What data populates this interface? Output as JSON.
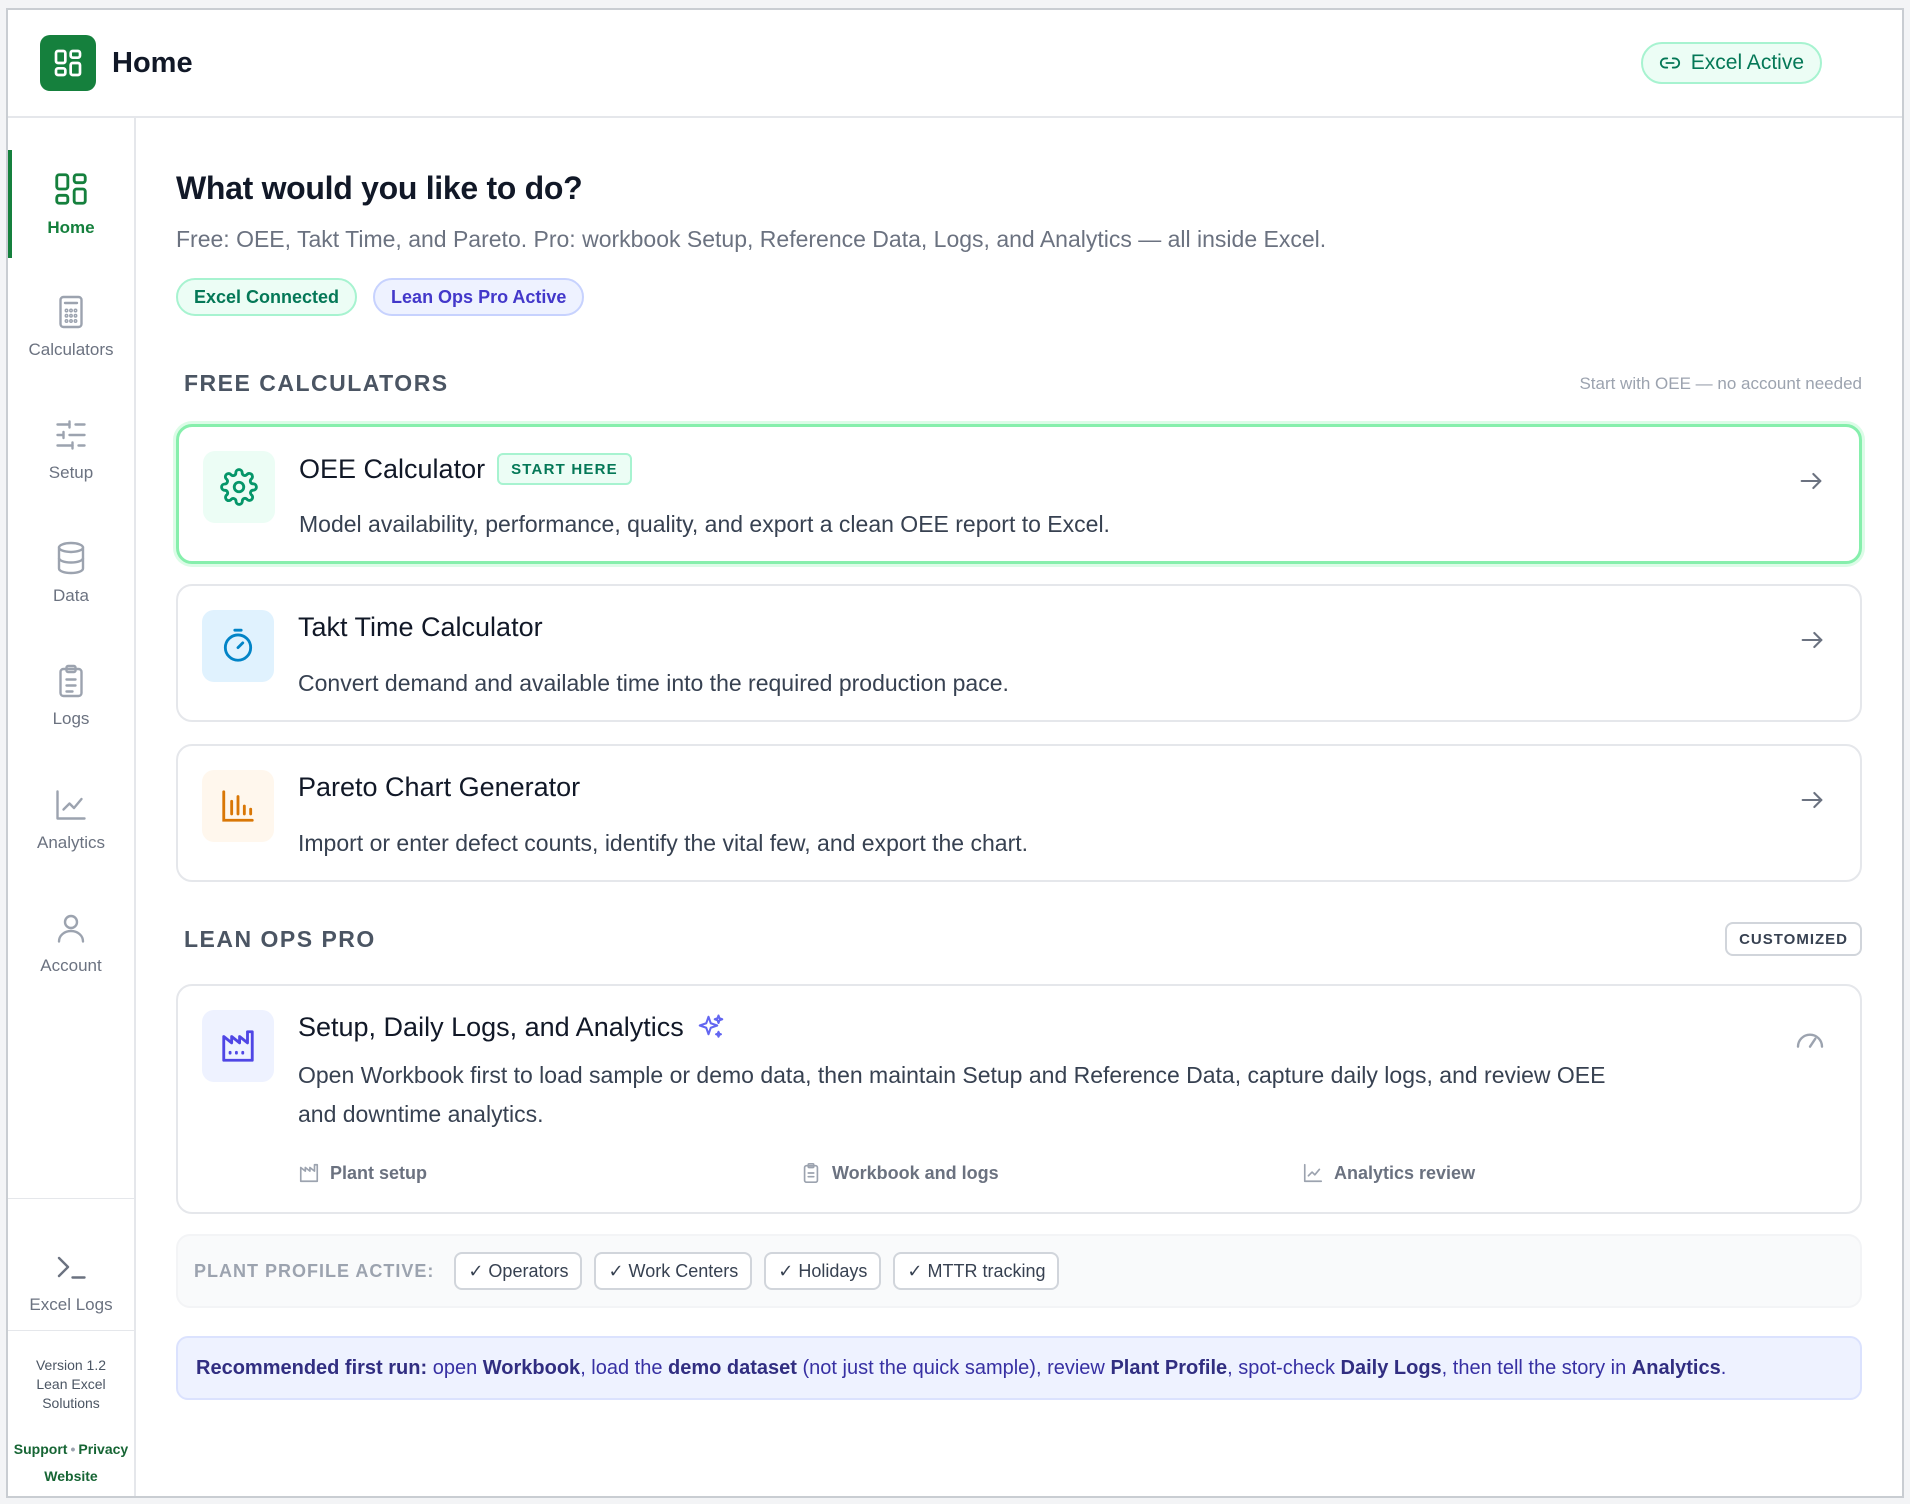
{
  "header": {
    "title": "Home",
    "status_label": "Excel Active"
  },
  "sidebar": {
    "items": [
      {
        "label": "Home",
        "icon": "grid-icon",
        "active": true
      },
      {
        "label": "Calculators",
        "icon": "calculator-icon"
      },
      {
        "label": "Setup",
        "icon": "sliders-icon"
      },
      {
        "label": "Data",
        "icon": "database-icon"
      },
      {
        "label": "Logs",
        "icon": "clipboard-icon"
      },
      {
        "label": "Analytics",
        "icon": "line-chart-icon"
      },
      {
        "label": "Account",
        "icon": "user-icon"
      }
    ],
    "excel_logs_label": "Excel Logs",
    "version": "Version 1.2",
    "company_line1": "Lean Excel",
    "company_line2": "Solutions",
    "support_link": "Support",
    "separator": "•",
    "privacy_link": "Privacy",
    "website_link": "Website"
  },
  "main": {
    "heading": "What would you like to do?",
    "subtitle": "Free: OEE, Takt Time, and Pareto. Pro: workbook Setup, Reference Data, Logs, and Analytics — all inside Excel.",
    "pills": [
      "Excel Connected",
      "Lean Ops Pro Active"
    ],
    "free_section": {
      "title": "FREE CALCULATORS",
      "note": "Start with OEE — no account needed"
    },
    "cards": [
      {
        "title": "OEE Calculator",
        "tag": "START HERE",
        "desc": "Model availability, performance, quality, and export a clean OEE report to Excel."
      },
      {
        "title": "Takt Time Calculator",
        "desc": "Convert demand and available time into the required production pace."
      },
      {
        "title": "Pareto Chart Generator",
        "desc": "Import or enter defect counts, identify the vital few, and export the chart."
      }
    ],
    "pro_section": {
      "title": "LEAN OPS PRO",
      "badge": "CUSTOMIZED"
    },
    "pro_card": {
      "title": "Setup, Daily Logs, and Analytics",
      "desc_line1": "Open Workbook first to load sample or demo data, then maintain Setup and Reference Data, capture daily logs, and review OEE",
      "desc_line2": "and downtime analytics.",
      "features": [
        "Plant setup",
        "Workbook and logs",
        "Analytics review"
      ]
    },
    "profile": {
      "label": "PLANT PROFILE ACTIVE:",
      "chips": [
        "✓ Operators",
        "✓ Work Centers",
        "✓ Holidays",
        "✓ MTTR tracking"
      ]
    },
    "recommendation": {
      "lead": "Recommended first run:",
      "t1": " open ",
      "b1": "Workbook",
      "t2": ", load the ",
      "b2": "demo dataset",
      "t3": " (not just the quick sample), review ",
      "b3": "Plant Profile",
      "t4": ", spot-check ",
      "b4": "Daily Logs",
      "t5": ", then tell the story in ",
      "b5": "Analytics",
      "t6": "."
    }
  },
  "colors": {
    "brand": "#15803d",
    "accent_indigo": "#4338ca"
  }
}
